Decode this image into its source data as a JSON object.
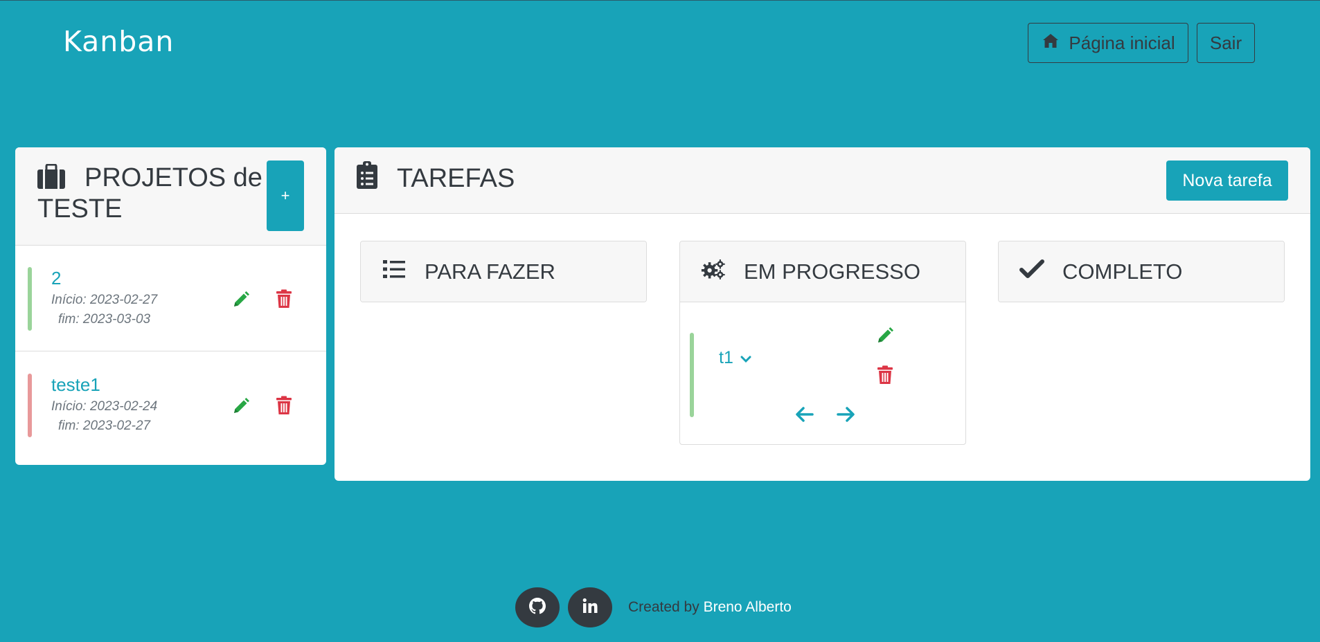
{
  "navbar": {
    "brand": "Kanban",
    "home_label": "Página inicial",
    "logout_label": "Sair"
  },
  "projects": {
    "title": "PROJETOS de TESTE",
    "add_label": "+",
    "items": [
      {
        "name": "2",
        "start": "Início: 2023-02-27",
        "end": "fim: 2023-03-03",
        "status_color": "#9ad49a"
      },
      {
        "name": "teste1",
        "start": "Início: 2023-02-24",
        "end": "fim: 2023-02-27",
        "status_color": "#e8999a"
      }
    ]
  },
  "tasks": {
    "title": "TAREFAS",
    "new_task_label": "Nova tarefa",
    "columns": [
      {
        "title": "PARA FAZER",
        "icon": "list-icon",
        "tasks": []
      },
      {
        "title": "EM PROGRESSO",
        "icon": "cogs-icon",
        "tasks": [
          {
            "name": "t1",
            "status_color": "#9ad49a"
          }
        ]
      },
      {
        "title": "COMPLETO",
        "icon": "check-icon",
        "tasks": []
      }
    ]
  },
  "footer": {
    "created_by": "Created by",
    "author": "Breno Alberto",
    "links": [
      "github-icon",
      "linkedin-icon"
    ]
  },
  "colors": {
    "background": "#18a3b8",
    "accent": "#18a3b8",
    "dark": "#343a40",
    "edit": "#28a745",
    "delete": "#dc3545"
  }
}
